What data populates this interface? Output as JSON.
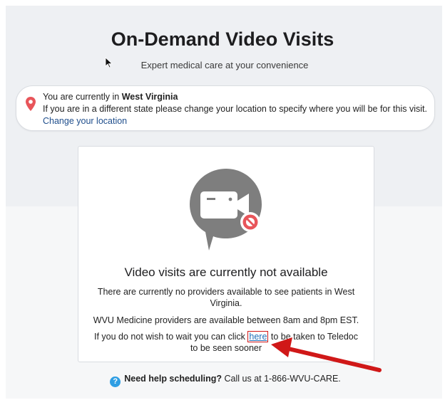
{
  "header": {
    "title": "On-Demand Video Visits",
    "subtitle": "Expert medical care at your convenience"
  },
  "location": {
    "prefix": "You are currently in ",
    "state": "West Virginia",
    "message": "If you are in a different state please change your location to specify where you will be for this visit.",
    "change_link": "Change your location",
    "pin_icon": "map-pin-icon",
    "pin_color": "#e8555a"
  },
  "status": {
    "illustration_icon": "video-camera-unavailable-icon",
    "title": "Video visits are currently not available",
    "no_providers": "There are currently no providers available to see patients in West Virginia.",
    "hours": "WVU Medicine providers are available between 8am and 8pm EST.",
    "wait_prefix": "If you do not wish to wait you can click ",
    "here_link": "here",
    "wait_suffix": " to be taken to Teledoc to be seen sooner"
  },
  "help": {
    "icon": "question-circle-icon",
    "bold": "Need help scheduling?",
    "text": " Call us at 1-866-WVU-CARE."
  },
  "colors": {
    "link": "#1f4e8c",
    "annotation": "#d01818",
    "help_icon": "#2f9ee3"
  }
}
